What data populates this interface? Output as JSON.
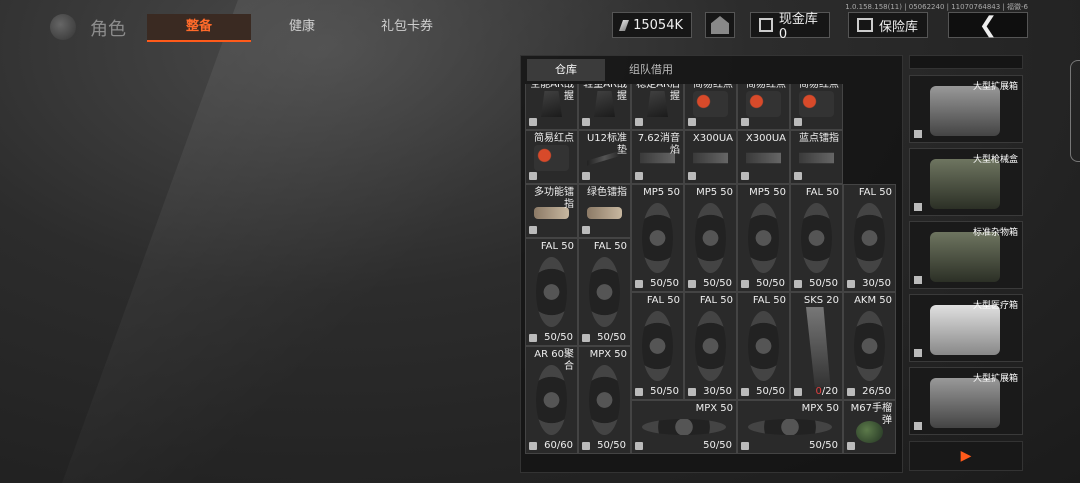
{
  "version": "1.0.158.158(11) | 05062240 | 11070764843 | 福徽-6",
  "header": {
    "title": "角色",
    "tabs": [
      {
        "label": "整备",
        "active": true
      },
      {
        "label": "健康",
        "active": false
      },
      {
        "label": "礼包卡券",
        "active": false
      }
    ],
    "money": "15054K",
    "cash_store": "现金库 0",
    "vault": "保险库",
    "back": "❮"
  },
  "warehouse": {
    "tabs": [
      {
        "label": "仓库",
        "active": true
      },
      {
        "label": "组队借用",
        "active": false
      }
    ],
    "rows": [
      [
        {
          "name": "全能AR战握",
          "count": "",
          "art": "grip"
        },
        {
          "name": "轻量AR战握",
          "count": "",
          "art": "grip"
        },
        {
          "name": "稳定AR后握",
          "count": "",
          "art": "grip"
        },
        {
          "name": "简易红点",
          "count": "",
          "art": "sight"
        },
        {
          "name": "简易红点",
          "count": "",
          "art": "sight"
        },
        {
          "name": "简易红点",
          "count": "",
          "art": "sight"
        }
      ],
      [
        {
          "name": "简易红点",
          "count": "",
          "art": "sight"
        },
        {
          "name": "U12标准垫",
          "count": "",
          "art": "rail"
        },
        {
          "name": "7.62消音焰",
          "count": "",
          "art": "light"
        },
        {
          "name": "X300UA",
          "count": "",
          "art": "light"
        },
        {
          "name": "X300UA",
          "count": "",
          "art": "light"
        },
        {
          "name": "蓝点镭指",
          "count": "",
          "art": "light"
        }
      ],
      [
        {
          "name": "多功能镭指",
          "count": "",
          "art": "laser"
        },
        {
          "name": "绿色镭指",
          "count": "",
          "art": "laser"
        },
        {
          "name": "MP5 50",
          "count": "50/50",
          "art": "drum"
        },
        {
          "name": "MP5 50",
          "count": "50/50",
          "art": "drum"
        },
        {
          "name": "MP5 50",
          "count": "50/50",
          "art": "drum"
        },
        {
          "name": "FAL 50",
          "count": "50/50",
          "art": "drum"
        },
        {
          "name": "FAL 50",
          "count": "30/50",
          "art": "drum"
        }
      ],
      [
        {
          "name": "FAL 50",
          "count": "50/50",
          "art": "drum"
        },
        {
          "name": "FAL 50",
          "count": "50/50",
          "art": "drum"
        },
        {
          "name": "FAL 50",
          "count": "50/50",
          "art": "drum"
        },
        {
          "name": "FAL 50",
          "count": "30/50",
          "art": "drum"
        },
        {
          "name": "FAL 50",
          "count": "50/50",
          "art": "drum"
        },
        {
          "name": "SKS 20",
          "count_red": "0",
          "count_rest": "/20",
          "art": "curved"
        },
        {
          "name": "AKM 50",
          "count": "26/50",
          "art": "drum"
        }
      ],
      [
        {
          "name": "AR 60聚合",
          "count": "60/60",
          "art": "drum"
        },
        {
          "name": "MPX 50",
          "count": "50/50",
          "art": "drum"
        },
        {
          "name": "MPX 50",
          "count": "50/50",
          "art": "drum"
        },
        {
          "name": "MPX 50",
          "count": "50/50",
          "art": "drum"
        },
        {
          "name": "M67手榴弹",
          "count": "",
          "art": "grenade"
        }
      ]
    ]
  },
  "containers": [
    {
      "name": "大型扩展箱",
      "style": "metal"
    },
    {
      "name": "大型枪械盒",
      "style": "green"
    },
    {
      "name": "标准杂物箱",
      "style": "green"
    },
    {
      "name": "大型医疗箱",
      "style": "white"
    },
    {
      "name": "大型扩展箱",
      "style": "metal"
    }
  ],
  "play_icon": "▶"
}
